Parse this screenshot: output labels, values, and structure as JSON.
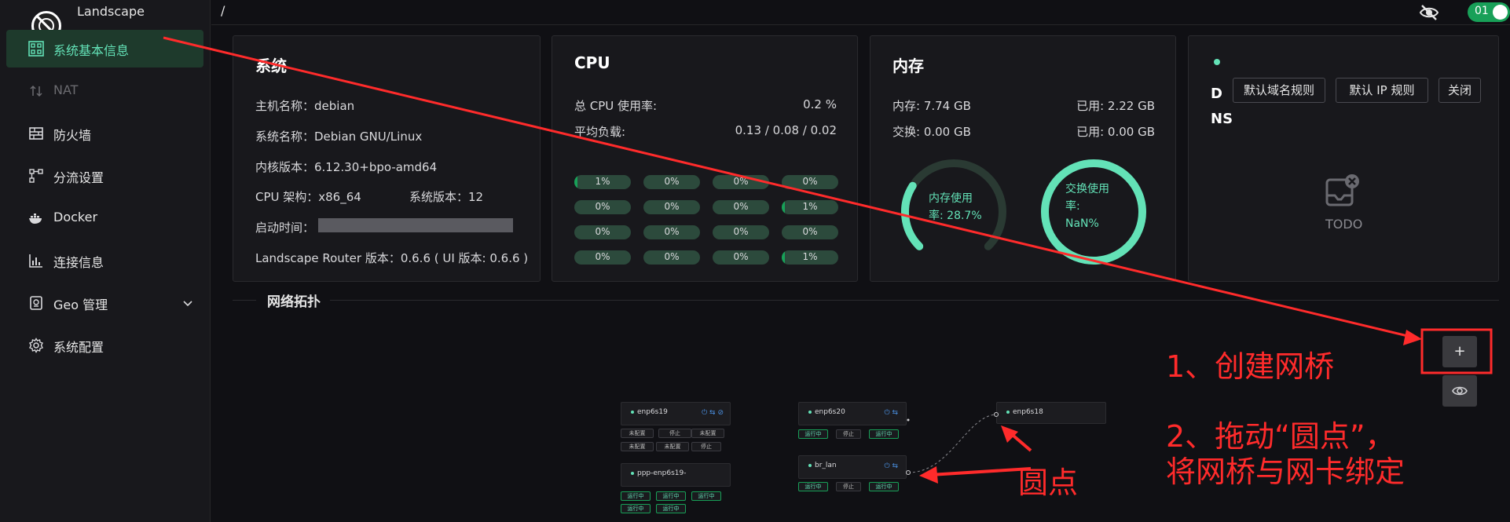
{
  "app": {
    "name": "Landscape"
  },
  "header": {
    "breadcrumb": "/",
    "toggle_value": "01"
  },
  "sidebar": {
    "items": [
      {
        "label": "系统基本信息",
        "icon": "grid-icon",
        "state": "active"
      },
      {
        "label": "NAT",
        "icon": "arrows-updown-icon",
        "state": "disabled"
      },
      {
        "label": "防火墙",
        "icon": "firewall-icon",
        "state": "normal"
      },
      {
        "label": "分流设置",
        "icon": "flow-icon",
        "state": "normal"
      },
      {
        "label": "Docker",
        "icon": "docker-icon",
        "state": "normal"
      },
      {
        "label": "连接信息",
        "icon": "chart-icon",
        "state": "normal"
      },
      {
        "label": "Geo 管理",
        "icon": "geo-icon",
        "state": "normal"
      },
      {
        "label": "系统配置",
        "icon": "gear-icon",
        "state": "normal"
      }
    ]
  },
  "system": {
    "title": "系统",
    "hostname": "主机名称：debian",
    "os": "系统名称：Debian GNU/Linux",
    "kernel": "内核版本：6.12.30+bpo-amd64",
    "arch": "CPU 架构：x86_64",
    "sys_version": "系统版本：12",
    "uptime_label": "启动时间：",
    "router_version": "Landscape Router 版本：0.6.6 ( UI 版本: 0.6.6 )"
  },
  "cpu": {
    "title": "CPU",
    "total_label": "总 CPU 使用率:",
    "total_value": "0.2 %",
    "load_label": "平均负载:",
    "load_value": "0.13 / 0.08 / 0.02",
    "cores": [
      "1%",
      "0%",
      "0%",
      "0%",
      "0%",
      "0%",
      "0%",
      "1%",
      "0%",
      "0%",
      "0%",
      "0%",
      "0%",
      "0%",
      "0%",
      "1%"
    ],
    "core_fractions": [
      0.01,
      0,
      0,
      0,
      0,
      0,
      0,
      0.01,
      0,
      0,
      0,
      0,
      0,
      0,
      0,
      0.01
    ]
  },
  "memory": {
    "title": "内存",
    "mem_total": "内存: 7.74 GB",
    "mem_used": "已用: 2.22 GB",
    "swap_total": "交换: 0.00 GB",
    "swap_used": "已用: 0.00 GB",
    "mem_gauge_label_1": "内存使用",
    "mem_gauge_label_2": "率: 28.7%",
    "mem_fraction": 0.287,
    "swap_gauge_label_1": "交换使用",
    "swap_gauge_label_2": "率:",
    "swap_gauge_label_3": "NaN%"
  },
  "dns": {
    "title_1": "D",
    "title_2": "NS",
    "btn_domain": "默认域名规则",
    "btn_ip": "默认 IP 规则",
    "btn_close": "关闭",
    "todo": "TODO"
  },
  "topology": {
    "title": "网络拓扑",
    "add_label": "+",
    "nodes": {
      "enp6s19": "enp6s19",
      "ppp": "ppp-enp6s19-",
      "enp6s20": "enp6s20",
      "br_lan": "br_lan",
      "enp6s18": "enp6s18"
    },
    "tags": {
      "unconfigured": "未配置",
      "stopped": "停止",
      "running": "运行中"
    }
  },
  "annotations": {
    "step1": "1、创建网桥",
    "step2_line1": "2、拖动“圆点”，",
    "step2_line2": "将网桥与网卡绑定",
    "dot_label": "圆点"
  },
  "colors": {
    "accent": "#63e2b7",
    "annotation": "#ff2b2b",
    "toggle": "#18a058"
  }
}
